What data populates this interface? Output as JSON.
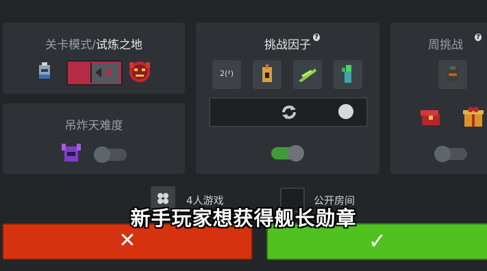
{
  "level_mode": {
    "title_prefix": "关卡模式/",
    "title_mode": "试炼之地"
  },
  "hanging_bomb": {
    "title": "吊炸天难度",
    "toggle_state": "off"
  },
  "challenge_factors": {
    "title": "挑战因子",
    "help_glyph": "?",
    "tile1_text": "2(²)",
    "toggle_state": "on"
  },
  "weekly_challenge": {
    "title": "周挑战",
    "help_glyph": "?",
    "toggle_state": "off"
  },
  "options": {
    "four_player_label": "4人游戏",
    "public_room_label": "公开房间"
  },
  "subtitle": "新手玩家想获得舰长勋章",
  "buttons": {
    "cancel_glyph": "✕",
    "confirm_glyph": "✓"
  },
  "colors": {
    "cancel": "#d6320f",
    "confirm": "#4fc21f",
    "toggle_on": "#3f9a37"
  }
}
